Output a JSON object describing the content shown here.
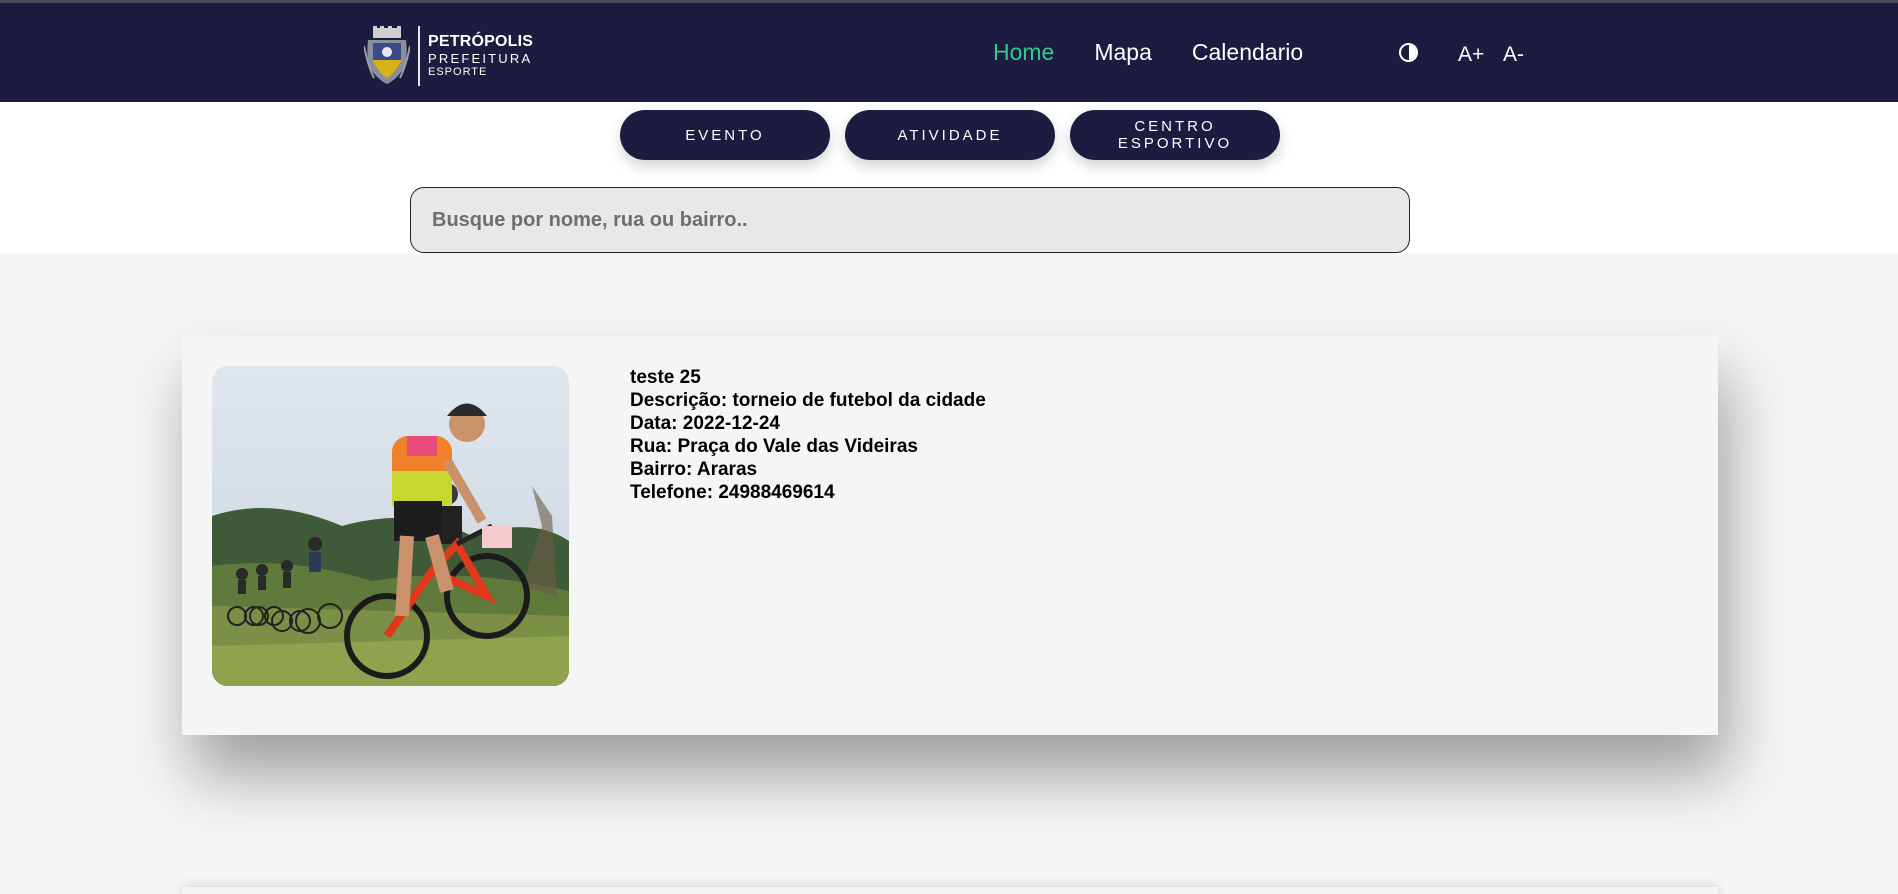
{
  "header": {
    "logo": {
      "line1": "PETRÓPOLIS",
      "line2": "PREFEITURA",
      "line3": "ESPORTE"
    },
    "nav": [
      {
        "label": "Home",
        "active": true
      },
      {
        "label": "Mapa",
        "active": false
      },
      {
        "label": "Calendario",
        "active": false
      }
    ],
    "contrast_icon": "contrast-icon",
    "font_increase": "A+",
    "font_decrease": "A-",
    "colors": {
      "background": "#1c1b40",
      "active": "#2ecc8a"
    }
  },
  "filters": [
    {
      "label": "EVENTO"
    },
    {
      "label": "ATIVIDADE"
    },
    {
      "label": "CENTRO ESPORTIVO"
    }
  ],
  "search": {
    "placeholder": "Busque por nome, rua ou bairro..",
    "value": ""
  },
  "cards": [
    {
      "title": "teste 25",
      "descricao": "Descrição: torneio de futebol da cidade",
      "data": "Data: 2022-12-24",
      "rua": "Rua: Praça do Vale das Videiras",
      "bairro": "Bairro: Araras",
      "telefone": "Telefone: 24988469614",
      "image": "mountain-bike-race-photo"
    }
  ]
}
